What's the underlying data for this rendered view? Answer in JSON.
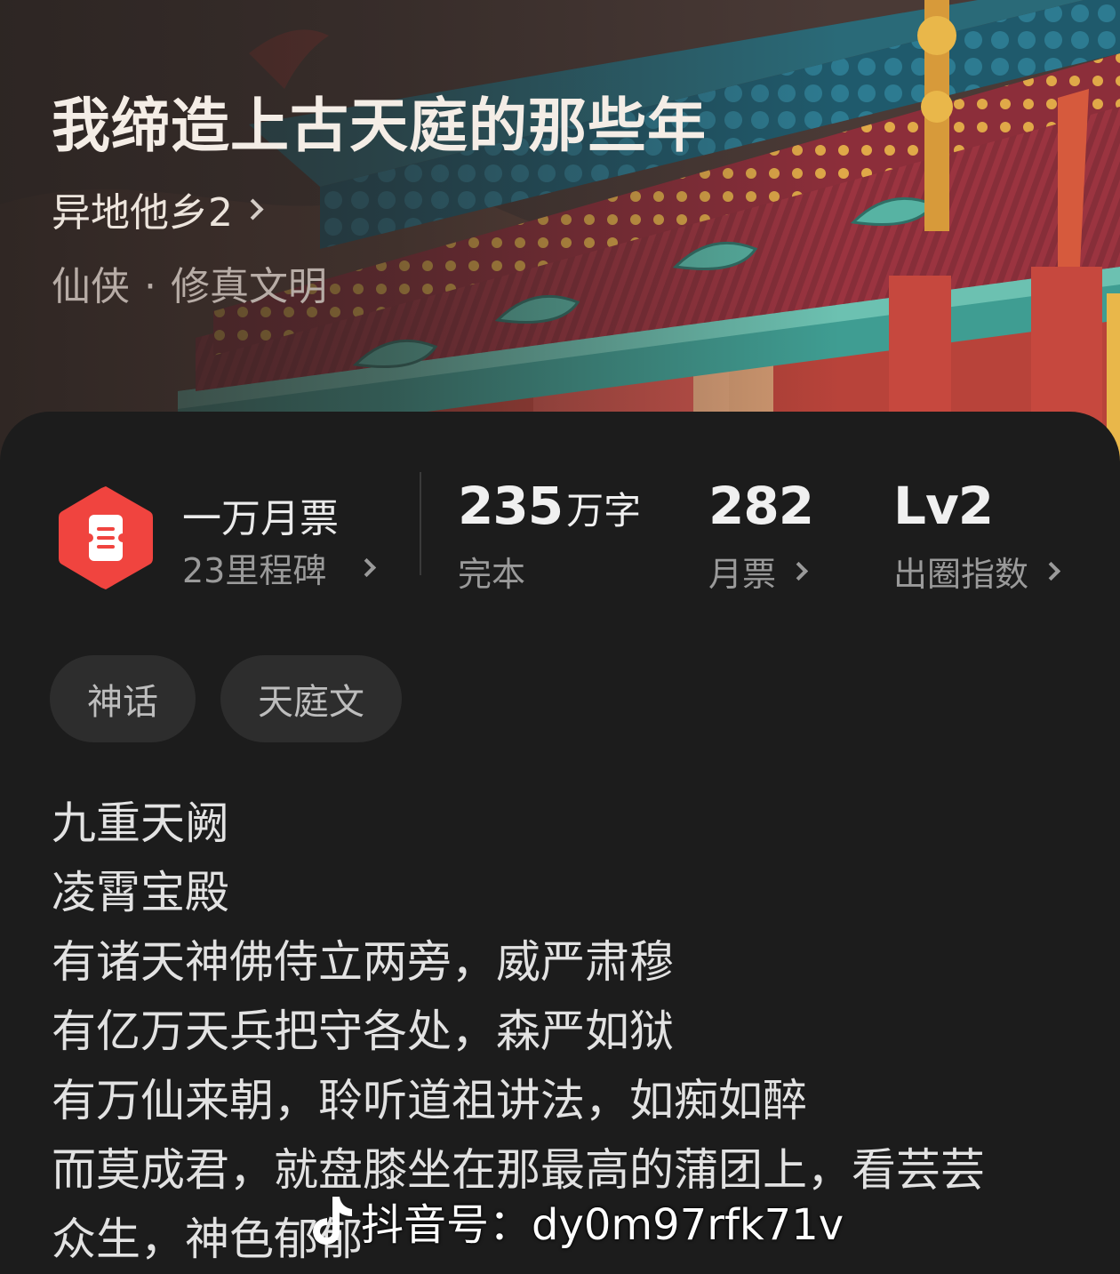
{
  "book": {
    "title": "我缔造上古天庭的那些年",
    "author": "异地他乡2",
    "genre_main": "仙侠",
    "genre_separator": "·",
    "genre_sub": "修真文明"
  },
  "milestone": {
    "title": "一万月票",
    "subtitle": "23里程碑"
  },
  "stats": {
    "words_number": "235",
    "words_unit": "万字",
    "words_label": "完本",
    "votes_value": "282",
    "votes_label": "月票",
    "level_value": "Lv2",
    "level_label": "出圈指数"
  },
  "tags": [
    "神话",
    "天庭文"
  ],
  "synopsis": [
    "九重天阙",
    "凌霄宝殿",
    "有诸天神佛侍立两旁，威严肃穆",
    "有亿万天兵把守各处，森严如狱",
    "有万仙来朝，聆听道祖讲法，如痴如醉",
    "而莫成君，就盘膝坐在那最高的蒲团上，看芸芸",
    "众生，神色郁郁"
  ],
  "watermark": {
    "icon": "tiktok-icon",
    "text": "抖音号：dy0m97rfk71v"
  },
  "colors": {
    "background": "#1c1c1c",
    "badge_red": "#f0443f",
    "tag_bg": "#2d2d2d"
  }
}
